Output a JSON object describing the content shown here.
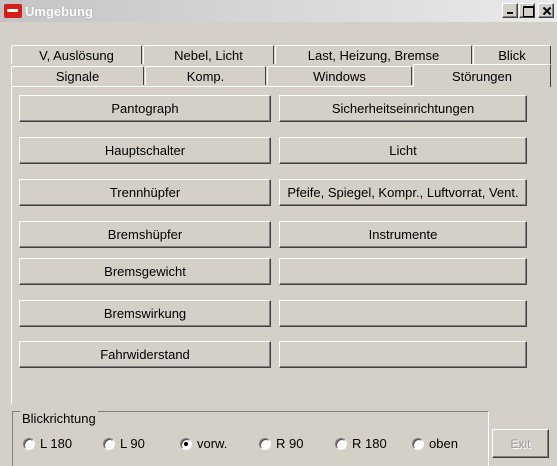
{
  "window": {
    "title": "Umgebung"
  },
  "tabs_row1": [
    {
      "label": "V, Auslösung"
    },
    {
      "label": "Nebel, Licht"
    },
    {
      "label": "Last, Heizung, Bremse"
    },
    {
      "label": "Blick"
    }
  ],
  "tabs_row2": [
    {
      "label": "Signale"
    },
    {
      "label": "Komp."
    },
    {
      "label": "Windows"
    },
    {
      "label": "Störungen"
    }
  ],
  "active_tab": "Störungen",
  "buttons_left": [
    {
      "label": "Pantograph"
    },
    {
      "label": "Hauptschalter"
    },
    {
      "label": "Trennhüpfer"
    },
    {
      "label": "Bremshüpfer"
    },
    {
      "label": "Bremsgewicht"
    },
    {
      "label": "Bremswirkung"
    },
    {
      "label": "Fahrwiderstand"
    }
  ],
  "buttons_right": [
    {
      "label": "Sicherheitseinrichtungen"
    },
    {
      "label": "Licht"
    },
    {
      "label": "Pfeife, Spiegel, Kompr., Luftvorrat, Vent."
    },
    {
      "label": "Instrumente"
    },
    {
      "label": ""
    },
    {
      "label": ""
    },
    {
      "label": ""
    }
  ],
  "blickrichtung": {
    "label": "Blickrichtung",
    "options": [
      {
        "label": "L 180",
        "checked": false
      },
      {
        "label": "L 90",
        "checked": false
      },
      {
        "label": "vorw.",
        "checked": true
      },
      {
        "label": "R 90",
        "checked": false
      },
      {
        "label": "R 180",
        "checked": false
      },
      {
        "label": "oben",
        "checked": false
      }
    ]
  },
  "exit_label": "Exit"
}
